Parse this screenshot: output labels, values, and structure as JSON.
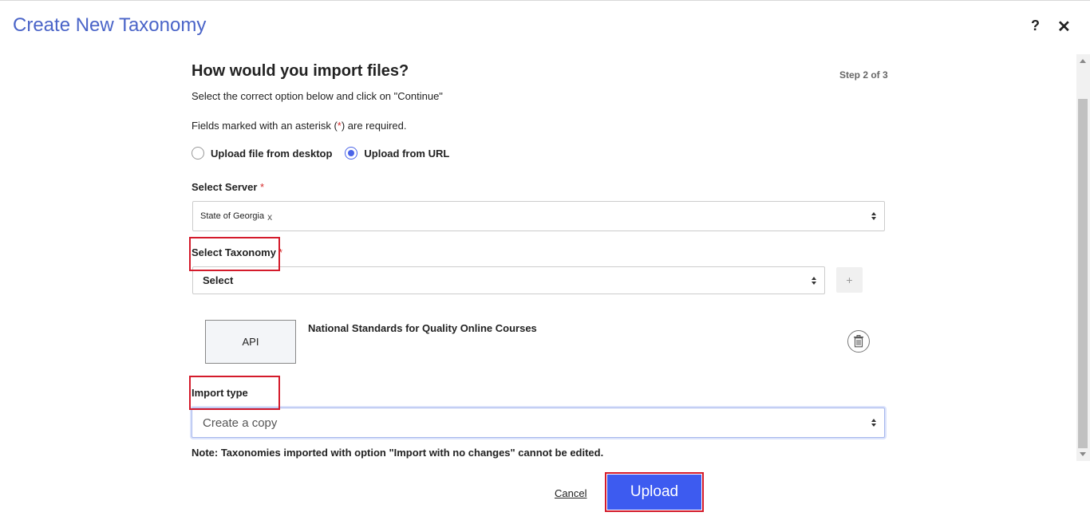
{
  "header": {
    "title": "Create New Taxonomy",
    "help_label": "?",
    "close_label": "✕"
  },
  "form": {
    "heading": "How would you import files?",
    "step_indicator": "Step 2 of 3",
    "instruction": "Select the correct option below and click on \"Continue\"",
    "required_note_prefix": "Fields marked with an asterisk (",
    "required_note_asterisk": "*",
    "required_note_suffix": ") are required.",
    "import_source": {
      "options": [
        {
          "label": "Upload file from desktop",
          "checked": false
        },
        {
          "label": "Upload from URL",
          "checked": true
        }
      ]
    },
    "server": {
      "label": "Select Server",
      "required_marker": "*",
      "selected_chip": "State of Georgia",
      "chip_remove": "x"
    },
    "taxonomy": {
      "label": "Select Taxonomy",
      "required_marker": "*",
      "value": "Select",
      "add_label": "+"
    },
    "selected_item": {
      "source_badge": "API",
      "name": "National Standards for Quality Online Courses",
      "delete_icon": "trash-icon"
    },
    "import_type": {
      "label": "Import type",
      "value": "Create a copy"
    },
    "note": "Note: Taxonomies imported with option \"Import with no changes\" cannot be edited.",
    "actions": {
      "cancel_label": "Cancel",
      "upload_label": "Upload"
    }
  },
  "colors": {
    "title": "#4a64c8",
    "primary_button": "#3d5bf0",
    "highlight": "#d41b2b",
    "required": "#d62b2b"
  }
}
